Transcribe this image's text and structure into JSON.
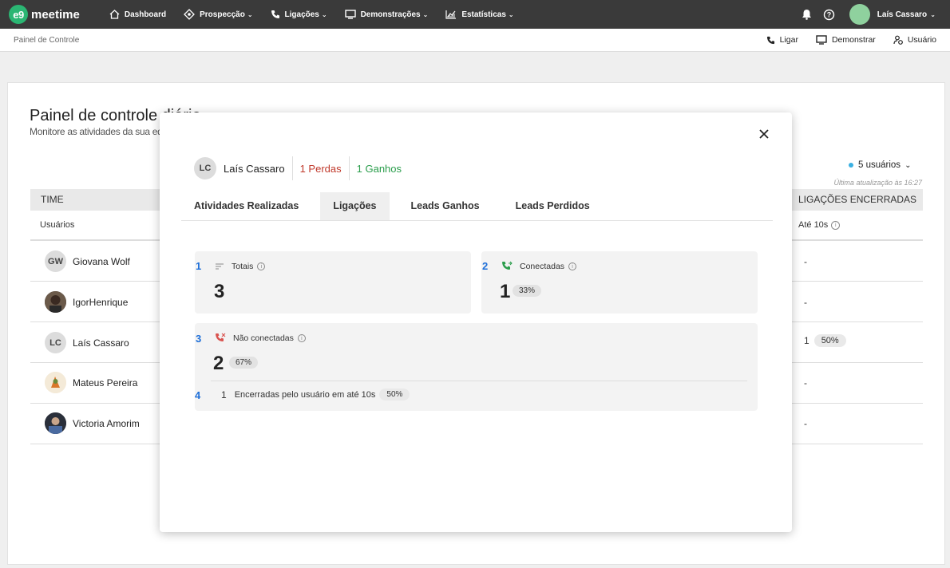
{
  "topnav": {
    "logo_badge": "e9",
    "logo_text": "meetime",
    "items": [
      {
        "label": "Dashboard"
      },
      {
        "label": "Prospecção"
      },
      {
        "label": "Ligações"
      },
      {
        "label": "Demonstrações"
      },
      {
        "label": "Estatísticas"
      }
    ],
    "user_name": "Laís Cassaro"
  },
  "subbar": {
    "breadcrumb": "Painel de Controle",
    "actions": [
      {
        "label": "Ligar"
      },
      {
        "label": "Demonstrar"
      },
      {
        "label": "Usuário"
      }
    ]
  },
  "panel": {
    "title": "Painel de controle diário",
    "subtitle": "Monitore as atividades da sua equipe",
    "users_filter": "5 usuários",
    "last_update": "Última atualização às 16:27",
    "team_header": "TIME",
    "users_header": "Usuários",
    "right_header": "LIGAÇÕES ENCERRADAS",
    "right_subheader": "Até 10s",
    "rows": [
      {
        "name": "Giovana Wolf",
        "initials": "GW",
        "value": "-"
      },
      {
        "name": "IgorHenrique",
        "initials": "",
        "value": "-"
      },
      {
        "name": "Laís Cassaro",
        "initials": "LC",
        "value": "1",
        "pct": "50%"
      },
      {
        "name": "Mateus Pereira",
        "initials": "",
        "value": "-"
      },
      {
        "name": "Victoria Amorim",
        "initials": "",
        "value": "-"
      }
    ]
  },
  "modal": {
    "initials": "LC",
    "name": "Laís Cassaro",
    "losses": "1 Perdas",
    "gains": "1 Ganhos",
    "tabs": [
      {
        "label": "Atividades Realizadas"
      },
      {
        "label": "Ligações"
      },
      {
        "label": "Leads Ganhos"
      },
      {
        "label": "Leads Perdidos"
      }
    ],
    "cards": {
      "totals": {
        "num": "1",
        "title": "Totais",
        "value": "3"
      },
      "connected": {
        "num": "2",
        "title": "Conectadas",
        "value": "1",
        "pct": "33%"
      },
      "not_connected": {
        "num": "3",
        "title": "Não conectadas",
        "value": "2",
        "pct": "67%"
      },
      "ended": {
        "num": "4",
        "count": "1",
        "label": "Encerradas pelo usuário em até 10s",
        "pct": "50%"
      }
    }
  },
  "colors": {
    "topnav_bg": "#3a3a3a",
    "brand_green": "#2bb673",
    "number_blue": "#1e6fd9",
    "loss_red": "#c0392b",
    "gain_green": "#2a9d4b"
  }
}
